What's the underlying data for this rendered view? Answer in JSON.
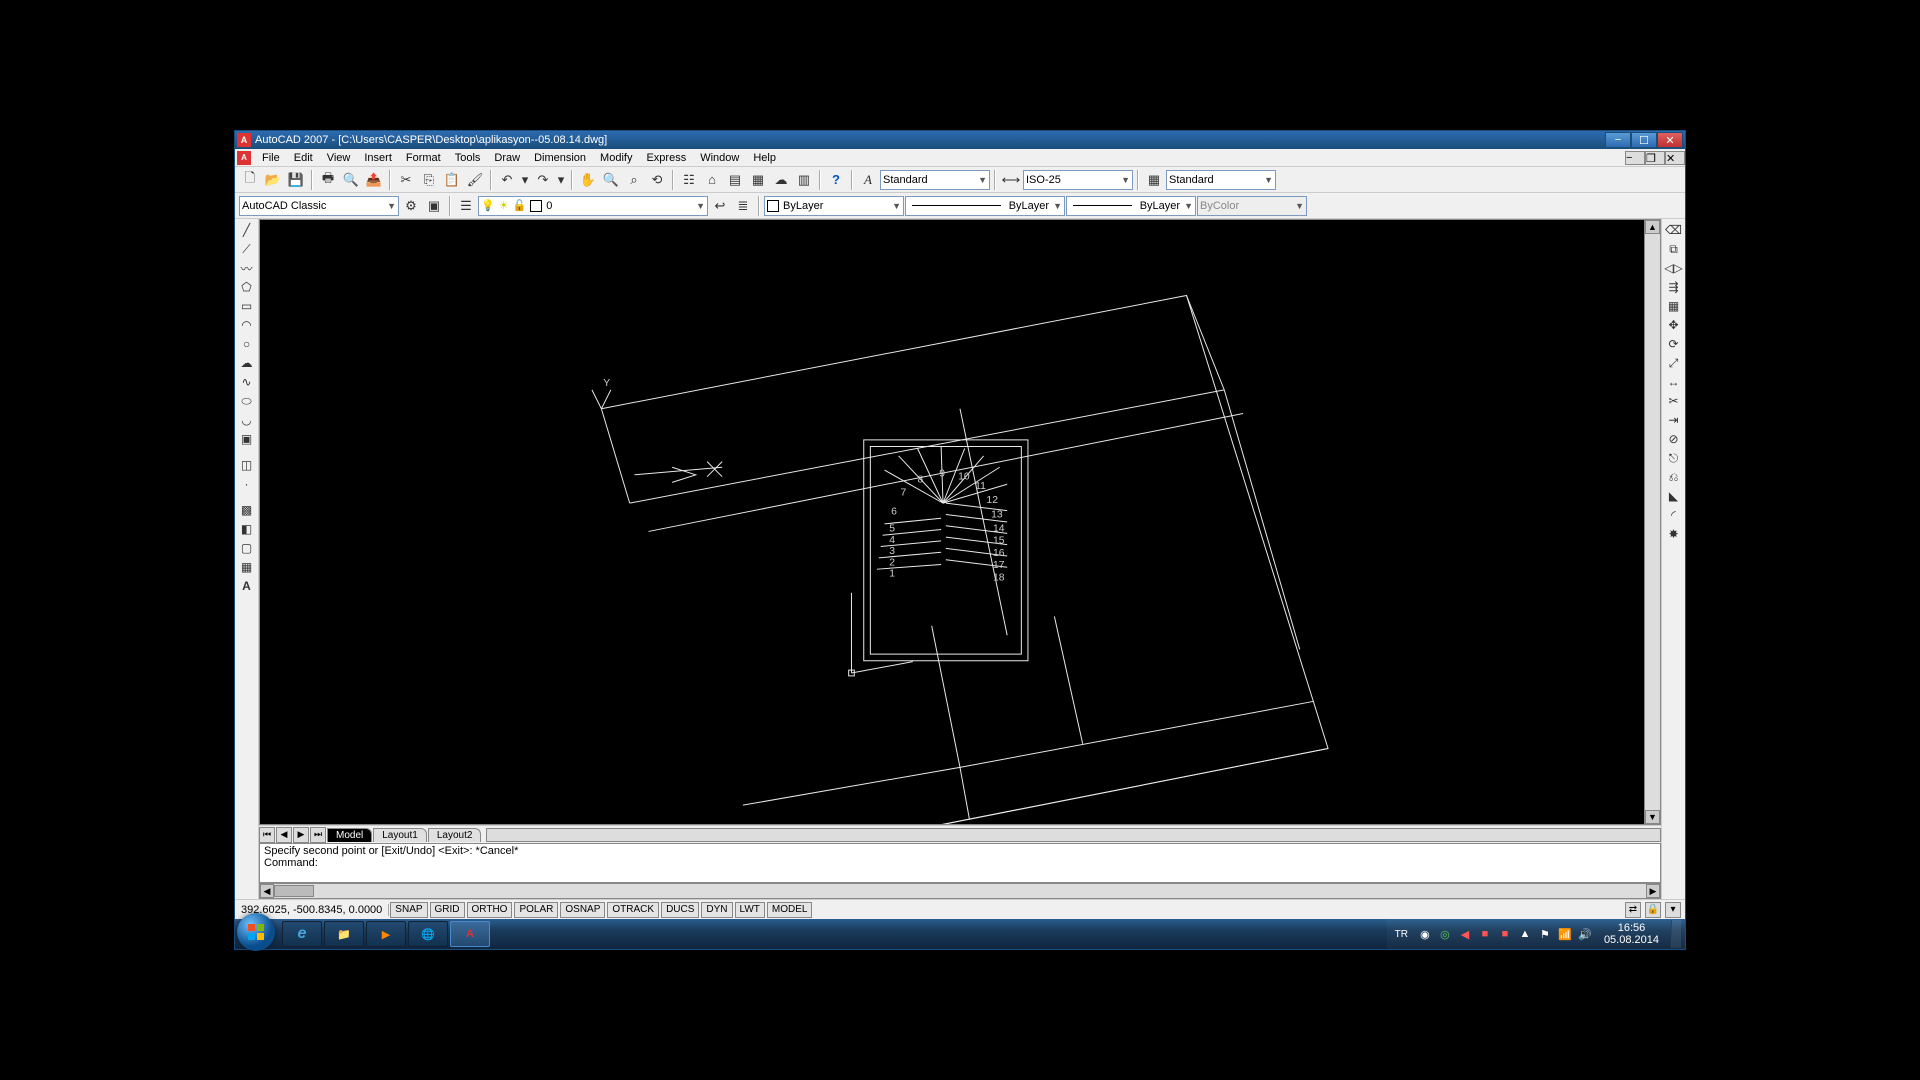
{
  "window": {
    "app": "AutoCAD 2007",
    "document_path": "[C:\\Users\\CASPER\\Desktop\\aplikasyon--05.08.14.dwg]"
  },
  "menus": [
    "File",
    "Edit",
    "View",
    "Insert",
    "Format",
    "Tools",
    "Draw",
    "Dimension",
    "Modify",
    "Express",
    "Window",
    "Help"
  ],
  "styles": {
    "text_style": "Standard",
    "dim_style": "ISO-25",
    "table_style": "Standard"
  },
  "workspace_combo": "AutoCAD Classic",
  "layer_combo": "0",
  "props": {
    "color": "ByLayer",
    "linetype": "ByLayer",
    "lineweight": "ByLayer",
    "plotstyle": "ByColor"
  },
  "layout_tabs": {
    "active": "Model",
    "others": [
      "Layout1",
      "Layout2"
    ]
  },
  "command": {
    "history": "Specify second point or [Exit/Undo] <Exit>: *Cancel*",
    "prompt": "Command:"
  },
  "status": {
    "coords": "392.6025, -500.8345, 0.0000",
    "toggles": [
      "SNAP",
      "GRID",
      "ORTHO",
      "POLAR",
      "OSNAP",
      "OTRACK",
      "DUCS",
      "DYN",
      "LWT",
      "MODEL"
    ]
  },
  "taskbar": {
    "lang": "TR",
    "time": "16:56",
    "date": "05.08.2014"
  },
  "stair_labels": [
    "1",
    "2",
    "3",
    "4",
    "5",
    "6",
    "7",
    "8",
    "9",
    "10",
    "11",
    "12",
    "13",
    "14",
    "15",
    "16",
    "17",
    "18"
  ]
}
